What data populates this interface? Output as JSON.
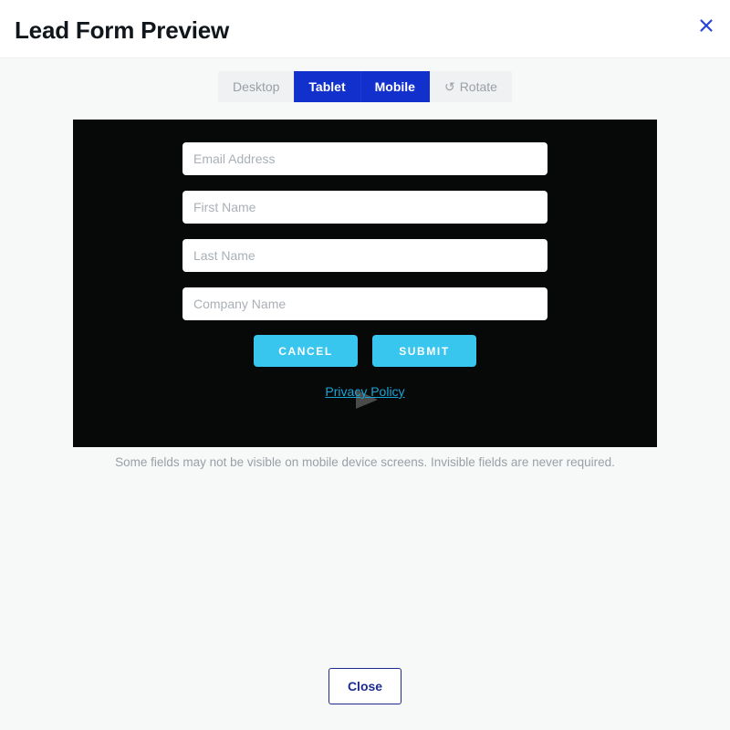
{
  "header": {
    "title": "Lead Form Preview",
    "close_icon": "close-x-icon"
  },
  "device_toolbar": {
    "buttons": [
      {
        "label": "Desktop",
        "active": false,
        "icon": null
      },
      {
        "label": "Tablet",
        "active": true,
        "icon": null
      },
      {
        "label": "Mobile",
        "active": true,
        "icon": null
      },
      {
        "label": "Rotate",
        "active": false,
        "icon": "rotate-ccw-icon",
        "glyph": "↺"
      }
    ]
  },
  "preview": {
    "background_color": "#070808",
    "cursor_icon": "mouse-pointer-arrow-icon",
    "fields": [
      {
        "name": "email",
        "placeholder": "Email Address",
        "value": ""
      },
      {
        "name": "first-name",
        "placeholder": "First Name",
        "value": ""
      },
      {
        "name": "last-name",
        "placeholder": "Last Name",
        "value": ""
      },
      {
        "name": "company-name",
        "placeholder": "Company Name",
        "value": ""
      }
    ],
    "buttons": [
      {
        "name": "cancel",
        "label": "CANCEL",
        "color": "#38c5ee"
      },
      {
        "name": "submit",
        "label": "SUBMIT",
        "color": "#38c5ee"
      }
    ],
    "privacy_link": "Privacy Policy"
  },
  "helper_note": "Some fields may not be visible on mobile device screens. Invisible fields are never required.",
  "footer": {
    "close_label": "Close"
  },
  "colors": {
    "accent_blue": "#1230cc",
    "form_cyan": "#38c5ee",
    "link_cyan": "#18a5d6",
    "navy": "#1d2c8c",
    "page_bg": "#f7f8f8",
    "toolbar_bg": "#f0f1f2",
    "muted_text": "#9aa0a6"
  }
}
